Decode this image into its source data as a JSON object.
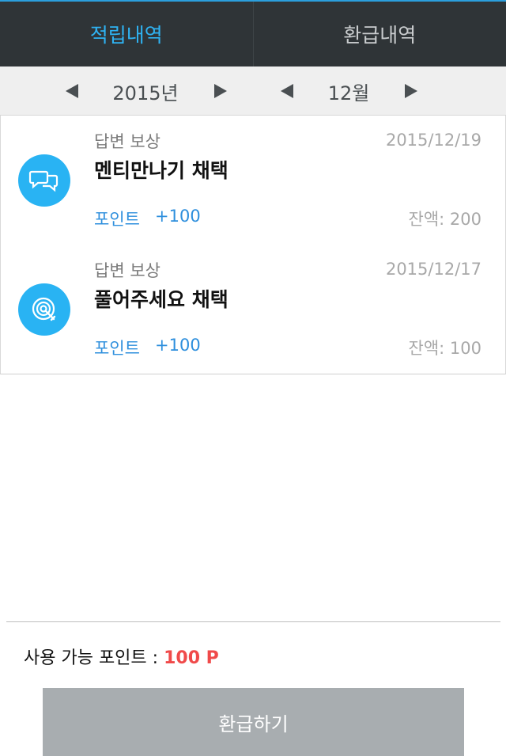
{
  "tabs": [
    {
      "label": "적립내역",
      "active": true
    },
    {
      "label": "환급내역",
      "active": false
    }
  ],
  "date_selector": {
    "year": "2015년",
    "month": "12월"
  },
  "items": [
    {
      "icon": "chat-bubbles-icon",
      "category": "답변 보상",
      "date": "2015/12/19",
      "title": "멘티만나기 채택",
      "point_label": "포인트",
      "point_value": "+100",
      "balance": "잔액: 200"
    },
    {
      "icon": "target-icon",
      "category": "답변 보상",
      "date": "2015/12/17",
      "title": "풀어주세요 채택",
      "point_label": "포인트",
      "point_value": "+100",
      "balance": "잔액: 100"
    }
  ],
  "footer": {
    "available_label": "사용 가능 포인트 : ",
    "available_amount": "100 P",
    "refund_button": "환급하기"
  },
  "colors": {
    "tab_bg": "#2f3437",
    "tab_active": "#2fb3f3",
    "icon_bg": "#29b3f3",
    "point_blue": "#2e8fdd",
    "amount_red": "#f04a4a",
    "button_gray": "#a8adb0"
  }
}
